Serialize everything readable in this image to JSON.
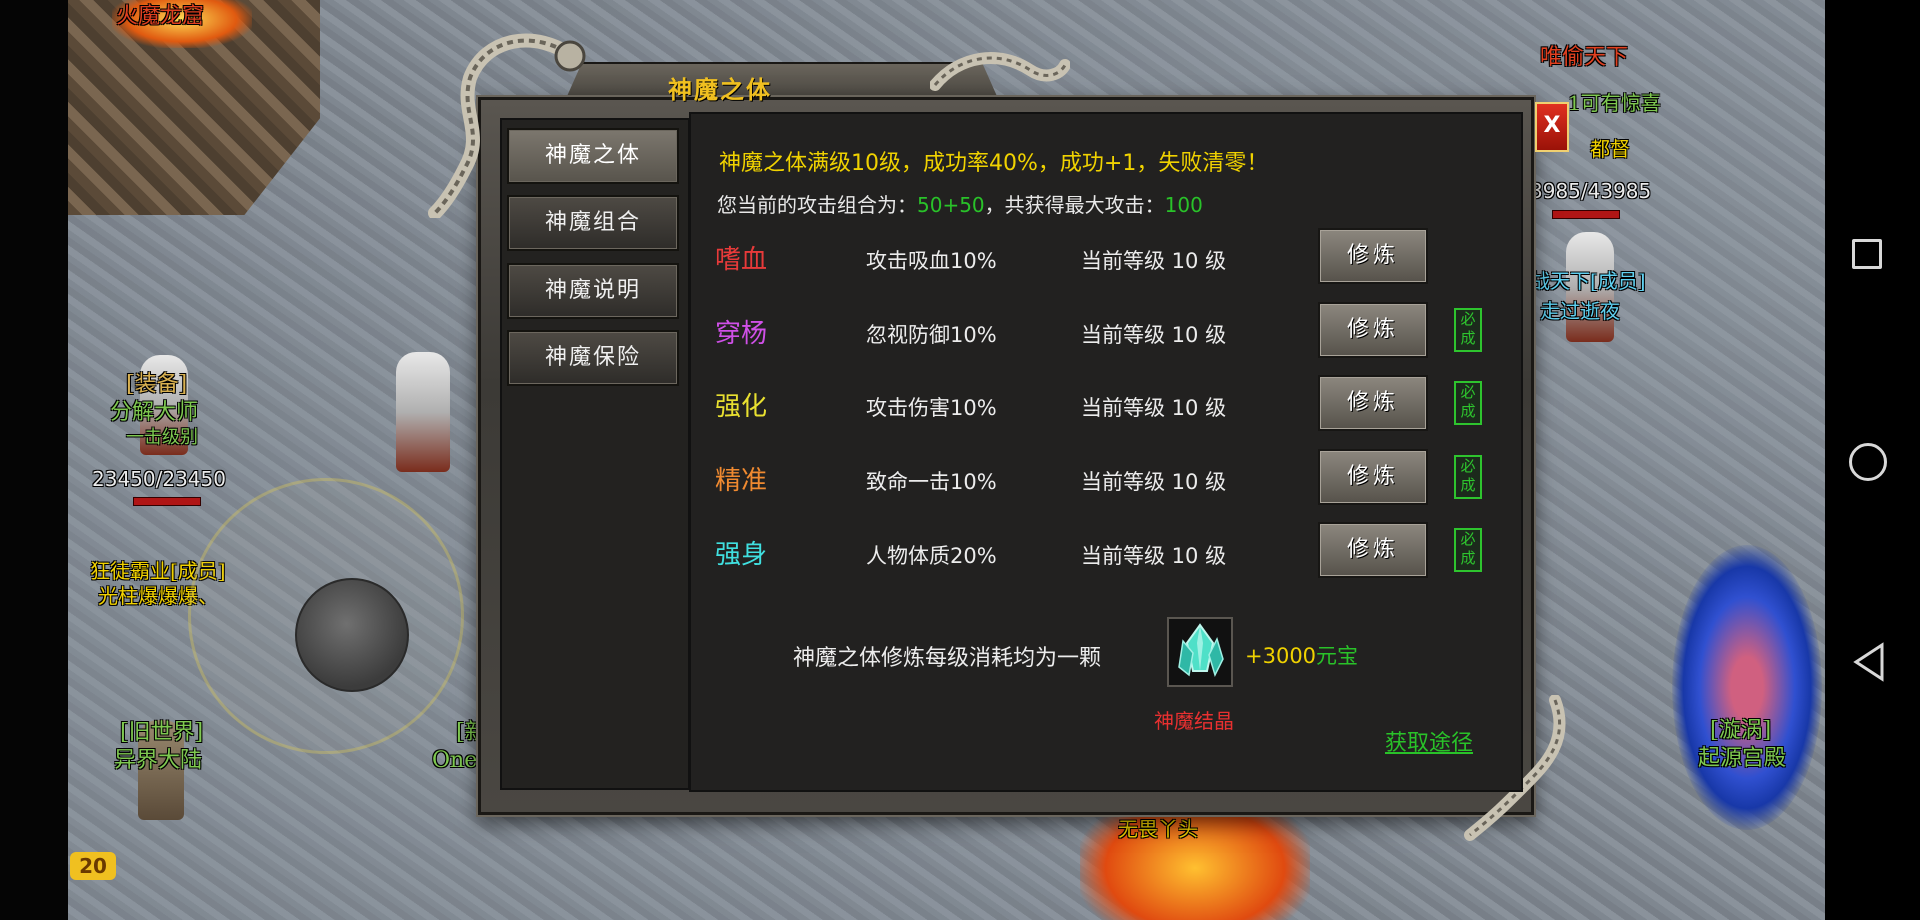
{
  "dialog": {
    "title": "神魔之体",
    "close_label": "X",
    "tabs": [
      {
        "label": "神魔之体",
        "active": true
      },
      {
        "label": "神魔组合",
        "active": false
      },
      {
        "label": "神魔说明",
        "active": false
      },
      {
        "label": "神魔保险",
        "active": false
      }
    ],
    "headline": "神魔之体满级10级，成功率40%，成功+1，失败清零！",
    "combo": {
      "prefix": "您当前的攻击组合为：",
      "value": "50+50",
      "middle": "，共获得最大攻击：",
      "max_attack": "100"
    },
    "rows": [
      {
        "name": "嗜血",
        "color": "#e83a3a",
        "effect": "攻击吸血10%",
        "level": "当前等级 10 级",
        "button": "修炼",
        "badge": ""
      },
      {
        "name": "穿杨",
        "color": "#d050e8",
        "effect": "忽视防御10%",
        "level": "当前等级 10 级",
        "button": "修炼",
        "badge": "必成"
      },
      {
        "name": "强化",
        "color": "#e8e030",
        "effect": "攻击伤害10%",
        "level": "当前等级 10 级",
        "button": "修炼",
        "badge": "必成"
      },
      {
        "name": "精准",
        "color": "#f08a30",
        "effect": "致命一击10%",
        "level": "当前等级 10 级",
        "button": "修炼",
        "badge": "必成"
      },
      {
        "name": "强身",
        "color": "#40e0e0",
        "effect": "人物体质20%",
        "level": "当前等级 10 级",
        "button": "修炼",
        "badge": "必成"
      }
    ],
    "cost": {
      "text": "神魔之体修炼每级消耗均为一颗",
      "amount": "+3000",
      "currency": "元宝",
      "item_name": "神魔结晶",
      "item_icon": "crystal-icon"
    },
    "obtain_link": "获取途径"
  },
  "world": {
    "labels": {
      "top_left": "火魔龙窟",
      "equip_title": "[装备]",
      "equip_npc": "分解大师",
      "equip_npc_sub": "一击级别",
      "hp_left": "23450/23450",
      "guild_left": "狂徒霸业[成员]",
      "name_left": "光柱爆爆爆、",
      "old_world": "[旧世界]",
      "old_world_name": "异界大陆",
      "partial_new": "[新",
      "partial_one": "One",
      "right_guild_title": "唯偷天下",
      "right_guild_line": "1可有惊喜",
      "right_rank": "都督",
      "hp_right": "3985/43985",
      "right_member": "战天下[成员]",
      "right_name": "走过逝夜",
      "vortex_title": "[漩涡]",
      "vortex_name": "起源宫殿",
      "bottom_name": "无畏丫头"
    },
    "logo": "20"
  }
}
